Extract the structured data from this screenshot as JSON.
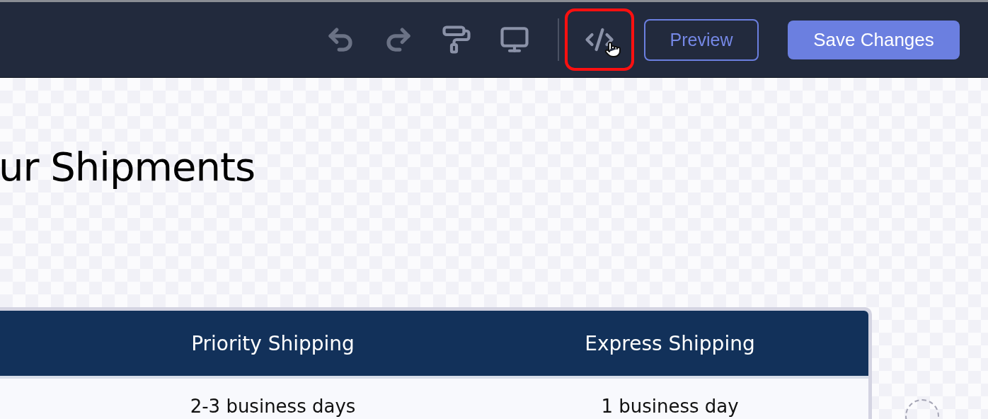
{
  "toolbar": {
    "tools": [
      {
        "kind": "undo",
        "disabled": true,
        "highlighted": false
      },
      {
        "kind": "redo",
        "disabled": true,
        "highlighted": false
      },
      {
        "kind": "paint",
        "disabled": false,
        "highlighted": false
      },
      {
        "kind": "monitor",
        "disabled": false,
        "highlighted": false
      },
      {
        "kind": "code",
        "disabled": false,
        "highlighted": true
      }
    ],
    "preview_button": "Preview",
    "save_button": "Save Changes"
  },
  "page": {
    "heading": "ur Shipments",
    "table": {
      "columns": [
        "Priority Shipping",
        "Express Shipping"
      ],
      "rows": [
        [
          "2-3 business days",
          "1 business day"
        ]
      ]
    }
  }
}
